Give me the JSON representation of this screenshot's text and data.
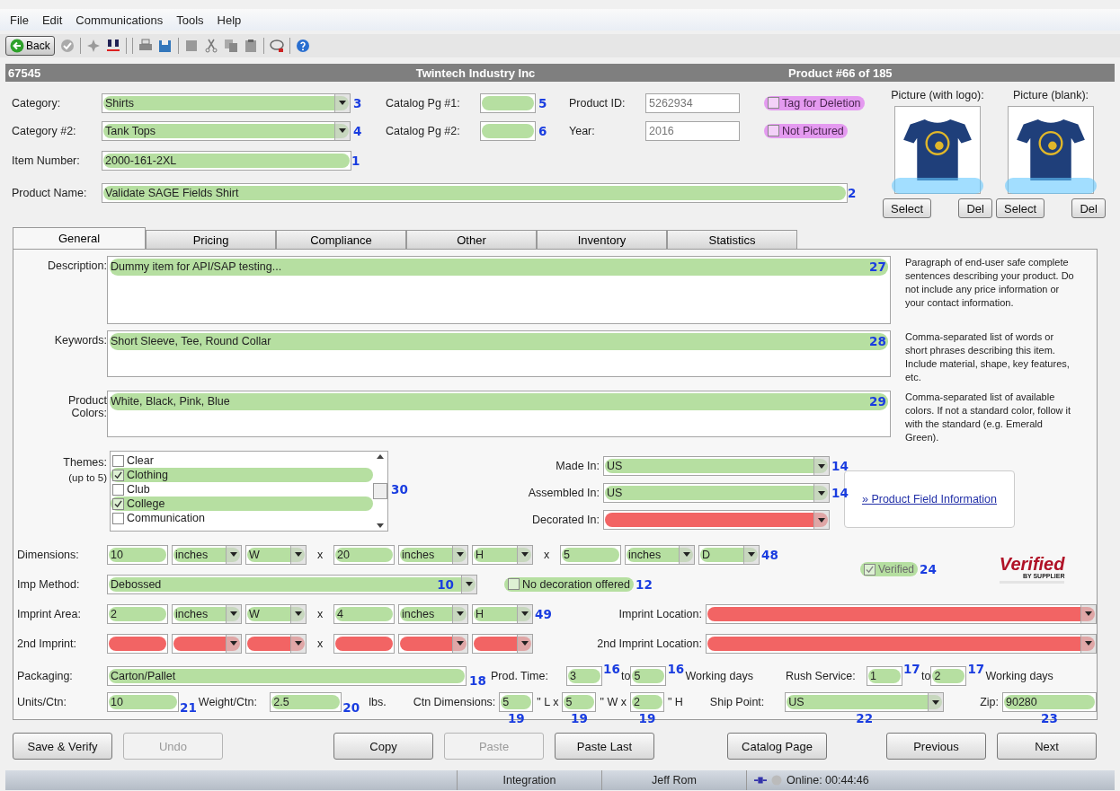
{
  "menu": [
    "File",
    "Edit",
    "Communications",
    "Tools",
    "Help"
  ],
  "toolbar": {
    "back": "Back"
  },
  "header": {
    "id": "67545",
    "company": "Twintech Industry Inc",
    "position": "Product #66 of 185"
  },
  "category": {
    "label": "Category:",
    "value": "Shirts",
    "kind": "select",
    "valid": true,
    "marker": "3"
  },
  "category_2": {
    "label": "Category #2:",
    "value": "Tank Tops",
    "kind": "select",
    "valid": true,
    "marker": "4"
  },
  "item_number": {
    "label": "Item Number:",
    "value": "2000-161-2XL",
    "kind": "text",
    "valid": true,
    "marker": "1"
  },
  "product_name": {
    "label": "Product Name:",
    "value": "Validate SAGE Fields Shirt",
    "kind": "text",
    "valid": true,
    "marker": "2"
  },
  "catalog_pg_1": {
    "label": "Catalog Pg #1:",
    "kind": "text",
    "valid": true,
    "marker": "5"
  },
  "catalog_pg_2": {
    "label": "Catalog Pg #2:",
    "kind": "text",
    "valid": true,
    "marker": "6"
  },
  "product_id": {
    "label": "Product ID:",
    "value": "5262934",
    "kind": "text",
    "disabled": true
  },
  "year": {
    "label": "Year:",
    "value": "2016",
    "kind": "text",
    "disabled": true
  },
  "flags": [
    {
      "label": "Tag for Deletion",
      "checked": false,
      "flagged": true
    },
    {
      "label": "Not Pictured",
      "checked": false,
      "flagged": true
    }
  ],
  "pictures": [
    {
      "label": "Picture (with logo):",
      "highlighted": true,
      "buttons": [
        "Select",
        "Del"
      ]
    },
    {
      "label": "Picture (blank):",
      "highlighted": true,
      "buttons": [
        "Select",
        "Del"
      ]
    }
  ],
  "tabs": [
    {
      "label": "General",
      "selected": true
    },
    {
      "label": "Pricing",
      "selected": false
    },
    {
      "label": "Compliance",
      "selected": false
    },
    {
      "label": "Other",
      "selected": false
    },
    {
      "label": "Inventory",
      "selected": false
    },
    {
      "label": "Statistics",
      "selected": false
    }
  ],
  "description": {
    "label": "Description:",
    "value": "Dummy item for API/SAP testing...",
    "valid": true,
    "marker": "27",
    "hint": "Paragraph of end-user safe complete sentences describing your product.  Do not include any price information or your contact information."
  },
  "keywords": {
    "label": "Keywords:",
    "value": "Short Sleeve, Tee, Round Collar",
    "valid": true,
    "marker": "28",
    "hint": "Comma-separated list of words or short phrases describing this item. Include material, shape, key features, etc."
  },
  "product_colors": {
    "label": "Product Colors:",
    "value": "White, Black, Pink, Blue",
    "valid": true,
    "marker": "29",
    "hint": "Comma-separated list of available colors.  If not a standard color, follow it with the standard (e.g. Emerald Green)."
  },
  "themes": {
    "label": "Themes:",
    "note": "(up to 5)",
    "marker": "30",
    "items": [
      {
        "label": "Clear",
        "checked": false
      },
      {
        "label": "Clothing",
        "checked": true,
        "valid": true
      },
      {
        "label": "Club",
        "checked": false
      },
      {
        "label": "College",
        "checked": true,
        "valid": true
      },
      {
        "label": "Communication",
        "checked": false
      }
    ]
  },
  "origin": [
    {
      "label": "Made In:",
      "value": "US",
      "kind": "select",
      "valid": true,
      "marker": "14"
    },
    {
      "label": "Assembled In:",
      "value": "US",
      "kind": "select",
      "valid": true,
      "marker": "14"
    },
    {
      "label": "Decorated In:",
      "kind": "select",
      "valid": false
    }
  ],
  "info_link": "» Product Field Information",
  "dimensions": {
    "label": "Dimensions:",
    "marker": "48",
    "parts": [
      {
        "kind": "text",
        "value": "10",
        "valid": true
      },
      {
        "kind": "select",
        "value": "inches",
        "valid": true
      },
      {
        "kind": "select",
        "value": "W",
        "valid": true
      },
      {
        "kind": "sep",
        "text": "x"
      },
      {
        "kind": "text",
        "value": "20",
        "valid": true
      },
      {
        "kind": "select",
        "value": "inches",
        "valid": true
      },
      {
        "kind": "select",
        "value": "H",
        "valid": true
      },
      {
        "kind": "sep",
        "text": "x"
      },
      {
        "kind": "text",
        "value": "5",
        "valid": true
      },
      {
        "kind": "select",
        "value": "inches",
        "valid": true
      },
      {
        "kind": "select",
        "value": "D",
        "valid": true
      }
    ]
  },
  "verified": {
    "label": "Verified",
    "checked": true,
    "disabled": true,
    "valid": true,
    "marker": "24"
  },
  "verified_logo": {
    "title": "Verified",
    "subtitle": "BY SUPPLIER"
  },
  "imp_method": {
    "label": "Imp Method:",
    "value": "Debossed",
    "kind": "select",
    "valid": true,
    "marker": "10"
  },
  "no_decoration": {
    "label": "No decoration offered",
    "checked": false,
    "valid": true,
    "marker": "12"
  },
  "imprint_area": {
    "label": "Imprint Area:",
    "marker": "49",
    "parts": [
      {
        "kind": "text",
        "value": "2",
        "valid": true
      },
      {
        "kind": "select",
        "value": "inches",
        "valid": true
      },
      {
        "kind": "select",
        "value": "W",
        "valid": true
      },
      {
        "kind": "sep",
        "text": "x"
      },
      {
        "kind": "text",
        "value": "4",
        "valid": true
      },
      {
        "kind": "select",
        "value": "inches",
        "valid": true
      },
      {
        "kind": "select",
        "value": "H",
        "valid": true
      }
    ]
  },
  "second_imprint": {
    "label": "2nd Imprint:",
    "parts": [
      {
        "kind": "text",
        "valid": false
      },
      {
        "kind": "select",
        "valid": false
      },
      {
        "kind": "select",
        "valid": false
      },
      {
        "kind": "sep",
        "text": "x"
      },
      {
        "kind": "text",
        "valid": false
      },
      {
        "kind": "select",
        "valid": false
      },
      {
        "kind": "select",
        "valid": false
      }
    ]
  },
  "imprint_location": {
    "label": "Imprint Location:",
    "kind": "select",
    "valid": false
  },
  "second_imprint_location": {
    "label": "2nd Imprint Location:",
    "kind": "select",
    "valid": false
  },
  "packaging": {
    "label": "Packaging:",
    "value": "Carton/Pallet",
    "kind": "text",
    "valid": true,
    "marker": "18"
  },
  "prod_time": {
    "label": "Prod. Time:",
    "from": {
      "value": "3",
      "kind": "text",
      "valid": true,
      "marker": "16"
    },
    "to_text": "to",
    "to": {
      "value": "5",
      "kind": "text",
      "valid": true,
      "marker": "16"
    },
    "unit": "Working days"
  },
  "rush_service": {
    "label": "Rush Service:",
    "from": {
      "value": "1",
      "kind": "text",
      "valid": true,
      "marker": "17"
    },
    "to_text": "to",
    "to": {
      "value": "2",
      "kind": "text",
      "valid": true,
      "marker": "17"
    },
    "unit": "Working days"
  },
  "units_ctn": {
    "label": "Units/Ctn:",
    "value": "10",
    "kind": "text",
    "valid": true,
    "marker": "21"
  },
  "weight_ctn": {
    "label": "Weight/Ctn:",
    "value": "2.5",
    "kind": "text",
    "valid": true,
    "marker": "20",
    "unit": "lbs."
  },
  "ctn_dimensions": {
    "label": "Ctn Dimensions:",
    "parts": [
      {
        "value": "5",
        "kind": "text",
        "valid": true,
        "marker": "19",
        "suffix": "\" L x"
      },
      {
        "value": "5",
        "kind": "text",
        "valid": true,
        "marker": "19",
        "suffix": "\" W x"
      },
      {
        "value": "2",
        "kind": "text",
        "valid": true,
        "marker": "19",
        "suffix": "\" H"
      }
    ]
  },
  "ship_point": {
    "label": "Ship Point:",
    "value": "US",
    "kind": "select",
    "valid": true,
    "marker": "22"
  },
  "zip": {
    "label": "Zip:",
    "value": "90280",
    "kind": "text",
    "valid": true,
    "marker": "23"
  },
  "buttons": [
    {
      "label": "Save & Verify",
      "disabled": false
    },
    {
      "label": "Undo",
      "disabled": true
    },
    {
      "label": "Copy",
      "disabled": false
    },
    {
      "label": "Paste",
      "disabled": true
    },
    {
      "label": "Paste Last",
      "disabled": false
    },
    {
      "label": "Catalog Page",
      "disabled": false
    },
    {
      "label": "Previous",
      "disabled": false
    },
    {
      "label": "Next",
      "disabled": false
    }
  ],
  "status_bar": [
    "Integration",
    "Jeff Rom",
    "Online: 00:44:46"
  ]
}
